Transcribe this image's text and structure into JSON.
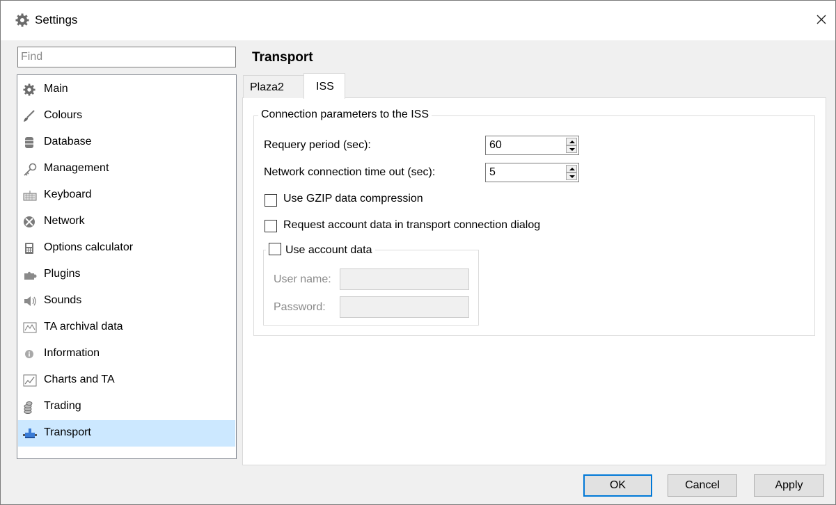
{
  "window": {
    "title": "Settings",
    "icon": "gear-icon"
  },
  "search": {
    "placeholder": "Find",
    "value": ""
  },
  "sidebar": {
    "items": [
      {
        "label": "Main",
        "icon": "gear-icon"
      },
      {
        "label": "Colours",
        "icon": "brush-icon"
      },
      {
        "label": "Database",
        "icon": "database-icon"
      },
      {
        "label": "Management",
        "icon": "key-icon"
      },
      {
        "label": "Keyboard",
        "icon": "keyboard-icon"
      },
      {
        "label": "Network",
        "icon": "network-icon"
      },
      {
        "label": "Options calculator",
        "icon": "calculator-icon"
      },
      {
        "label": "Plugins",
        "icon": "puzzle-icon"
      },
      {
        "label": "Sounds",
        "icon": "speaker-icon"
      },
      {
        "label": "TA archival data",
        "icon": "archive-chart-icon"
      },
      {
        "label": "Information",
        "icon": "info-icon"
      },
      {
        "label": "Charts and TA",
        "icon": "line-chart-icon"
      },
      {
        "label": "Trading",
        "icon": "coins-icon"
      },
      {
        "label": "Transport",
        "icon": "transport-icon"
      }
    ],
    "selected": "Transport"
  },
  "main": {
    "title": "Transport",
    "tabs": [
      {
        "label": "Plaza2"
      },
      {
        "label": "ISS"
      }
    ],
    "active_tab": "ISS",
    "connection_group": {
      "legend": "Connection parameters to the ISS",
      "requery_label": "Requery period (sec):",
      "requery_value": "60",
      "timeout_label": "Network connection time out (sec):",
      "timeout_value": "5",
      "gzip_label": "Use GZIP data compression",
      "gzip_checked": false,
      "request_account_label": "Request account data in transport connection dialog",
      "request_account_checked": false
    },
    "account_group": {
      "legend": "Use account data",
      "checked": false,
      "username_label": "User name:",
      "username_value": "",
      "password_label": "Password:",
      "password_value": ""
    }
  },
  "footer": {
    "ok_label": "OK",
    "cancel_label": "Cancel",
    "apply_label": "Apply"
  },
  "colors": {
    "selection": "#cce8ff",
    "default_button_border": "#0078d7",
    "disabled_text": "#8a8a8a"
  }
}
